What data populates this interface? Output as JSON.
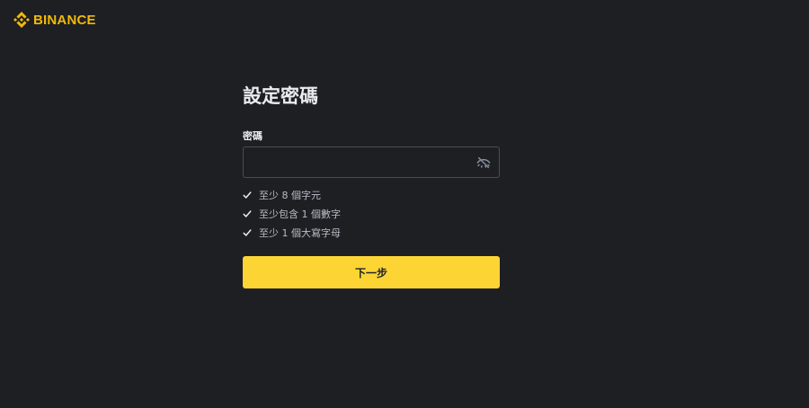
{
  "header": {
    "logo_text": "BINANCE",
    "logo_icon": "binance-logo-icon",
    "brand_color": "#F0B90B"
  },
  "main": {
    "title": "設定密碼",
    "password_label": "密碼",
    "password_value": "",
    "toggle_icon": "eye-off-icon",
    "rules": [
      {
        "text": "至少 8 個字元",
        "icon": "check-icon"
      },
      {
        "text": "至少包含 1 個數字",
        "icon": "check-icon"
      },
      {
        "text": "至少 1 個大寫字母",
        "icon": "check-icon"
      }
    ],
    "next_button_label": "下一步",
    "button_color": "#FCD535"
  }
}
